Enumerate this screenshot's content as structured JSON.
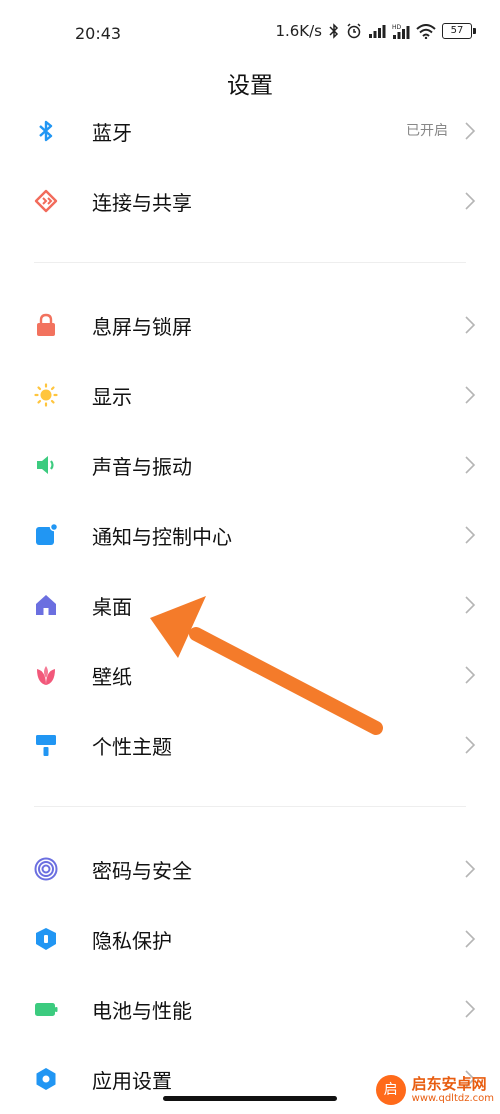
{
  "status_bar": {
    "time": "20:43",
    "network_speed": "1.6K/s",
    "battery": "57",
    "icons": [
      "bluetooth-icon",
      "alarm-icon",
      "signal-icon",
      "hd-signal-icon",
      "wifi-icon",
      "battery-icon"
    ]
  },
  "page": {
    "title": "设置"
  },
  "settings": [
    {
      "label": "蓝牙",
      "value": "已开启",
      "icon": "bluetooth-icon",
      "color": "#2196F3"
    },
    {
      "label": "连接与共享",
      "icon": "share-icon",
      "color": "#F26B5B"
    },
    {
      "label": "息屏与锁屏",
      "icon": "lock-icon",
      "color": "#F2725E"
    },
    {
      "label": "显示",
      "icon": "sun-icon",
      "color": "#FFC53D"
    },
    {
      "label": "声音与振动",
      "icon": "speaker-icon",
      "color": "#3CCB7F"
    },
    {
      "label": "通知与控制中心",
      "icon": "notification-icon",
      "color": "#2196F3"
    },
    {
      "label": "桌面",
      "icon": "home-icon",
      "color": "#6B6FE0"
    },
    {
      "label": "壁纸",
      "icon": "flower-icon",
      "color": "#F2587A"
    },
    {
      "label": "个性主题",
      "icon": "brush-icon",
      "color": "#2196F3"
    },
    {
      "label": "密码与安全",
      "icon": "fingerprint-icon",
      "color": "#6B6FE0"
    },
    {
      "label": "隐私保护",
      "icon": "shield-icon",
      "color": "#2196F3"
    },
    {
      "label": "电池与性能",
      "icon": "battery-icon",
      "color": "#3CCB7F"
    },
    {
      "label": "应用设置",
      "icon": "gear-icon",
      "color": "#2196F3"
    }
  ],
  "annotation": {
    "arrow_color": "#F47B2A",
    "arrow_target": "桌面"
  },
  "watermark": {
    "title": "启东安卓网",
    "url": "www.qdltdz.com",
    "logo_text": "启"
  }
}
